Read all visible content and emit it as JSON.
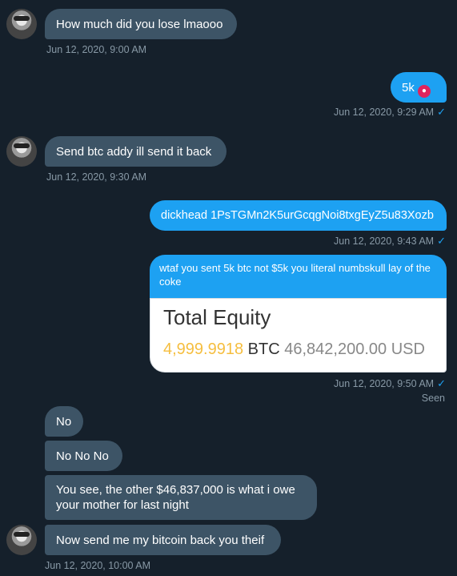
{
  "messages": {
    "m1": {
      "text": "How much did you lose lmaooo",
      "time": "Jun 12, 2020, 9:00 AM"
    },
    "m2": {
      "text": "5k",
      "emoji": "angry-face-emoji",
      "time": "Jun 12, 2020, 9:29 AM"
    },
    "m3": {
      "text": "Send btc addy ill send it back",
      "time": "Jun 12, 2020, 9:30 AM"
    },
    "m4": {
      "text": "dickhead 1PsTGMn2K5urGcqgNoi8txgEyZ5u83Xozb",
      "time": "Jun 12, 2020, 9:43 AM"
    },
    "m5": {
      "text": "wtaf you sent 5k btc not $5k you literal numbskull lay of the coke",
      "card": {
        "title": "Total Equity",
        "btc_amount": "4,999.9918",
        "btc_unit": "BTC",
        "usd_value": "46,842,200.00 USD"
      },
      "time": "Jun 12, 2020, 9:50 AM",
      "status": "Seen"
    },
    "m6": {
      "text": "No"
    },
    "m7": {
      "text": "No No No"
    },
    "m8": {
      "text": "You see, the other $46,837,000 is what i owe your mother for last night"
    },
    "m9": {
      "text": "Now send me my bitcoin back you theif",
      "time": "Jun 12, 2020, 10:00 AM"
    }
  },
  "read_mark": "✓",
  "colors": {
    "background": "#15202b",
    "received": "#3d5466",
    "sent": "#1da1f2",
    "timestamp": "#8899a6"
  }
}
